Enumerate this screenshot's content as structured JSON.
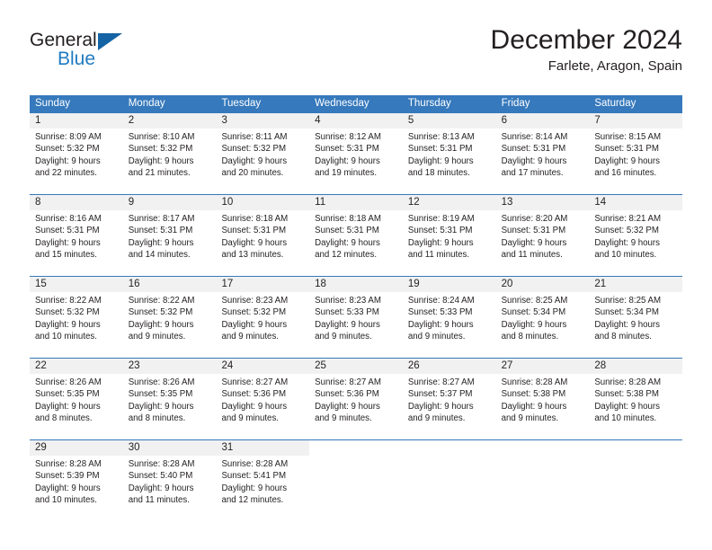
{
  "brand": {
    "name_part1": "General",
    "name_part2": "Blue",
    "accent_color": "#1f7bc1",
    "triangle_color": "#1463a5"
  },
  "header": {
    "title": "December 2024",
    "subtitle": "Farlete, Aragon, Spain"
  },
  "calendar": {
    "header_bg": "#3679bc",
    "day_band_bg": "#f1f1f1",
    "weekdays": [
      "Sunday",
      "Monday",
      "Tuesday",
      "Wednesday",
      "Thursday",
      "Friday",
      "Saturday"
    ],
    "weeks": [
      [
        {
          "day": "1",
          "sunrise": "Sunrise: 8:09 AM",
          "sunset": "Sunset: 5:32 PM",
          "daylight_line1": "Daylight: 9 hours",
          "daylight_line2": "and 22 minutes."
        },
        {
          "day": "2",
          "sunrise": "Sunrise: 8:10 AM",
          "sunset": "Sunset: 5:32 PM",
          "daylight_line1": "Daylight: 9 hours",
          "daylight_line2": "and 21 minutes."
        },
        {
          "day": "3",
          "sunrise": "Sunrise: 8:11 AM",
          "sunset": "Sunset: 5:32 PM",
          "daylight_line1": "Daylight: 9 hours",
          "daylight_line2": "and 20 minutes."
        },
        {
          "day": "4",
          "sunrise": "Sunrise: 8:12 AM",
          "sunset": "Sunset: 5:31 PM",
          "daylight_line1": "Daylight: 9 hours",
          "daylight_line2": "and 19 minutes."
        },
        {
          "day": "5",
          "sunrise": "Sunrise: 8:13 AM",
          "sunset": "Sunset: 5:31 PM",
          "daylight_line1": "Daylight: 9 hours",
          "daylight_line2": "and 18 minutes."
        },
        {
          "day": "6",
          "sunrise": "Sunrise: 8:14 AM",
          "sunset": "Sunset: 5:31 PM",
          "daylight_line1": "Daylight: 9 hours",
          "daylight_line2": "and 17 minutes."
        },
        {
          "day": "7",
          "sunrise": "Sunrise: 8:15 AM",
          "sunset": "Sunset: 5:31 PM",
          "daylight_line1": "Daylight: 9 hours",
          "daylight_line2": "and 16 minutes."
        }
      ],
      [
        {
          "day": "8",
          "sunrise": "Sunrise: 8:16 AM",
          "sunset": "Sunset: 5:31 PM",
          "daylight_line1": "Daylight: 9 hours",
          "daylight_line2": "and 15 minutes."
        },
        {
          "day": "9",
          "sunrise": "Sunrise: 8:17 AM",
          "sunset": "Sunset: 5:31 PM",
          "daylight_line1": "Daylight: 9 hours",
          "daylight_line2": "and 14 minutes."
        },
        {
          "day": "10",
          "sunrise": "Sunrise: 8:18 AM",
          "sunset": "Sunset: 5:31 PM",
          "daylight_line1": "Daylight: 9 hours",
          "daylight_line2": "and 13 minutes."
        },
        {
          "day": "11",
          "sunrise": "Sunrise: 8:18 AM",
          "sunset": "Sunset: 5:31 PM",
          "daylight_line1": "Daylight: 9 hours",
          "daylight_line2": "and 12 minutes."
        },
        {
          "day": "12",
          "sunrise": "Sunrise: 8:19 AM",
          "sunset": "Sunset: 5:31 PM",
          "daylight_line1": "Daylight: 9 hours",
          "daylight_line2": "and 11 minutes."
        },
        {
          "day": "13",
          "sunrise": "Sunrise: 8:20 AM",
          "sunset": "Sunset: 5:31 PM",
          "daylight_line1": "Daylight: 9 hours",
          "daylight_line2": "and 11 minutes."
        },
        {
          "day": "14",
          "sunrise": "Sunrise: 8:21 AM",
          "sunset": "Sunset: 5:32 PM",
          "daylight_line1": "Daylight: 9 hours",
          "daylight_line2": "and 10 minutes."
        }
      ],
      [
        {
          "day": "15",
          "sunrise": "Sunrise: 8:22 AM",
          "sunset": "Sunset: 5:32 PM",
          "daylight_line1": "Daylight: 9 hours",
          "daylight_line2": "and 10 minutes."
        },
        {
          "day": "16",
          "sunrise": "Sunrise: 8:22 AM",
          "sunset": "Sunset: 5:32 PM",
          "daylight_line1": "Daylight: 9 hours",
          "daylight_line2": "and 9 minutes."
        },
        {
          "day": "17",
          "sunrise": "Sunrise: 8:23 AM",
          "sunset": "Sunset: 5:32 PM",
          "daylight_line1": "Daylight: 9 hours",
          "daylight_line2": "and 9 minutes."
        },
        {
          "day": "18",
          "sunrise": "Sunrise: 8:23 AM",
          "sunset": "Sunset: 5:33 PM",
          "daylight_line1": "Daylight: 9 hours",
          "daylight_line2": "and 9 minutes."
        },
        {
          "day": "19",
          "sunrise": "Sunrise: 8:24 AM",
          "sunset": "Sunset: 5:33 PM",
          "daylight_line1": "Daylight: 9 hours",
          "daylight_line2": "and 9 minutes."
        },
        {
          "day": "20",
          "sunrise": "Sunrise: 8:25 AM",
          "sunset": "Sunset: 5:34 PM",
          "daylight_line1": "Daylight: 9 hours",
          "daylight_line2": "and 8 minutes."
        },
        {
          "day": "21",
          "sunrise": "Sunrise: 8:25 AM",
          "sunset": "Sunset: 5:34 PM",
          "daylight_line1": "Daylight: 9 hours",
          "daylight_line2": "and 8 minutes."
        }
      ],
      [
        {
          "day": "22",
          "sunrise": "Sunrise: 8:26 AM",
          "sunset": "Sunset: 5:35 PM",
          "daylight_line1": "Daylight: 9 hours",
          "daylight_line2": "and 8 minutes."
        },
        {
          "day": "23",
          "sunrise": "Sunrise: 8:26 AM",
          "sunset": "Sunset: 5:35 PM",
          "daylight_line1": "Daylight: 9 hours",
          "daylight_line2": "and 8 minutes."
        },
        {
          "day": "24",
          "sunrise": "Sunrise: 8:27 AM",
          "sunset": "Sunset: 5:36 PM",
          "daylight_line1": "Daylight: 9 hours",
          "daylight_line2": "and 9 minutes."
        },
        {
          "day": "25",
          "sunrise": "Sunrise: 8:27 AM",
          "sunset": "Sunset: 5:36 PM",
          "daylight_line1": "Daylight: 9 hours",
          "daylight_line2": "and 9 minutes."
        },
        {
          "day": "26",
          "sunrise": "Sunrise: 8:27 AM",
          "sunset": "Sunset: 5:37 PM",
          "daylight_line1": "Daylight: 9 hours",
          "daylight_line2": "and 9 minutes."
        },
        {
          "day": "27",
          "sunrise": "Sunrise: 8:28 AM",
          "sunset": "Sunset: 5:38 PM",
          "daylight_line1": "Daylight: 9 hours",
          "daylight_line2": "and 9 minutes."
        },
        {
          "day": "28",
          "sunrise": "Sunrise: 8:28 AM",
          "sunset": "Sunset: 5:38 PM",
          "daylight_line1": "Daylight: 9 hours",
          "daylight_line2": "and 10 minutes."
        }
      ],
      [
        {
          "day": "29",
          "sunrise": "Sunrise: 8:28 AM",
          "sunset": "Sunset: 5:39 PM",
          "daylight_line1": "Daylight: 9 hours",
          "daylight_line2": "and 10 minutes."
        },
        {
          "day": "30",
          "sunrise": "Sunrise: 8:28 AM",
          "sunset": "Sunset: 5:40 PM",
          "daylight_line1": "Daylight: 9 hours",
          "daylight_line2": "and 11 minutes."
        },
        {
          "day": "31",
          "sunrise": "Sunrise: 8:28 AM",
          "sunset": "Sunset: 5:41 PM",
          "daylight_line1": "Daylight: 9 hours",
          "daylight_line2": "and 12 minutes."
        },
        {
          "day": "",
          "sunrise": "",
          "sunset": "",
          "daylight_line1": "",
          "daylight_line2": ""
        },
        {
          "day": "",
          "sunrise": "",
          "sunset": "",
          "daylight_line1": "",
          "daylight_line2": ""
        },
        {
          "day": "",
          "sunrise": "",
          "sunset": "",
          "daylight_line1": "",
          "daylight_line2": ""
        },
        {
          "day": "",
          "sunrise": "",
          "sunset": "",
          "daylight_line1": "",
          "daylight_line2": ""
        }
      ]
    ]
  }
}
